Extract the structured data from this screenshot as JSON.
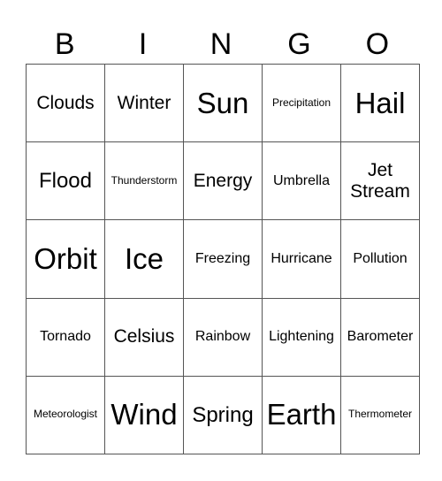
{
  "header": [
    "B",
    "I",
    "N",
    "G",
    "O"
  ],
  "rows": [
    [
      {
        "t": "Clouds",
        "s": "s3"
      },
      {
        "t": "Winter",
        "s": "s3"
      },
      {
        "t": "Sun",
        "s": "s5"
      },
      {
        "t": "Precipitation",
        "s": "s1"
      },
      {
        "t": "Hail",
        "s": "s5"
      }
    ],
    [
      {
        "t": "Flood",
        "s": "s4"
      },
      {
        "t": "Thunderstorm",
        "s": "s1"
      },
      {
        "t": "Energy",
        "s": "s3"
      },
      {
        "t": "Umbrella",
        "s": "s2"
      },
      {
        "t": "Jet Stream",
        "s": "s3"
      }
    ],
    [
      {
        "t": "Orbit",
        "s": "s5"
      },
      {
        "t": "Ice",
        "s": "s5"
      },
      {
        "t": "Freezing",
        "s": "s2"
      },
      {
        "t": "Hurricane",
        "s": "s2"
      },
      {
        "t": "Pollution",
        "s": "s2"
      }
    ],
    [
      {
        "t": "Tornado",
        "s": "s2"
      },
      {
        "t": "Celsius",
        "s": "s3"
      },
      {
        "t": "Rainbow",
        "s": "s2"
      },
      {
        "t": "Lightening",
        "s": "s2"
      },
      {
        "t": "Barometer",
        "s": "s2"
      }
    ],
    [
      {
        "t": "Meteorologist",
        "s": "s1"
      },
      {
        "t": "Wind",
        "s": "s5"
      },
      {
        "t": "Spring",
        "s": "s4"
      },
      {
        "t": "Earth",
        "s": "s5"
      },
      {
        "t": "Thermometer",
        "s": "s1"
      }
    ]
  ]
}
